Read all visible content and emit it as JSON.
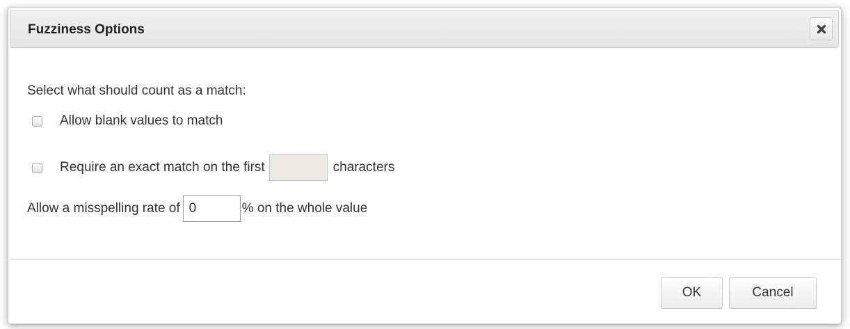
{
  "dialog": {
    "title": "Fuzziness Options",
    "close_icon": "close-x-icon"
  },
  "body": {
    "prompt": "Select what should count as a match:",
    "allow_blank": {
      "label": "Allow blank values to match",
      "checked": false
    },
    "exact_match": {
      "label_before": "Require an exact match on the first",
      "value": "",
      "label_after": "characters",
      "checked": false,
      "input_disabled": true
    },
    "misspelling": {
      "label_before": "Allow a misspelling rate of",
      "value": "0",
      "label_after": "% on the whole value"
    }
  },
  "footer": {
    "ok_label": "OK",
    "cancel_label": "Cancel"
  }
}
